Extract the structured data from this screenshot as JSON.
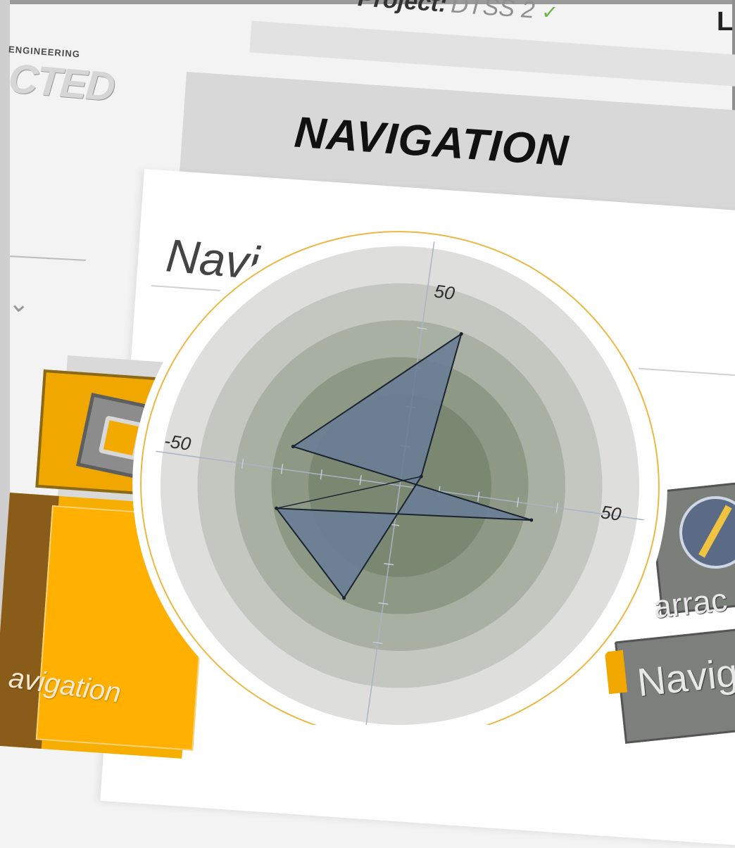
{
  "header": {
    "project_label": "Project:",
    "project_name": "DTSS 2",
    "right_letter": "L"
  },
  "logo": {
    "small_text": "ENGINEERING",
    "big_text": "CTED"
  },
  "banner": {
    "title": "NAVIGATION"
  },
  "panel": {
    "title": "Navi"
  },
  "tiles": {
    "left_label": "avigation",
    "right_label_1": "arrac",
    "right_label_2": "Navig"
  },
  "colors": {
    "accent_orange": "#f5ab00",
    "ring_orange": "#e9b845",
    "polygon_fill": "#6a7e96",
    "check_green": "#71b34a"
  },
  "icons": {
    "check": "check-icon",
    "tile_icon": "component-icon",
    "compass": "compass-icon",
    "chevron": "chevron-down-icon"
  },
  "chart_data": {
    "type": "scatter",
    "title": "",
    "axis_range": [
      -50,
      50
    ],
    "tick_labels": {
      "top": "50",
      "left": "-50",
      "right": "50"
    },
    "minor_tick_step": 10,
    "rings": 4,
    "polygon": [
      {
        "x": 10,
        "y": 40
      },
      {
        "x": -28,
        "y": 6
      },
      {
        "x": 34,
        "y": -4
      },
      {
        "x": -30,
        "y": -10
      },
      {
        "x": -10,
        "y": -30
      },
      {
        "x": 5,
        "y": 3
      }
    ]
  }
}
